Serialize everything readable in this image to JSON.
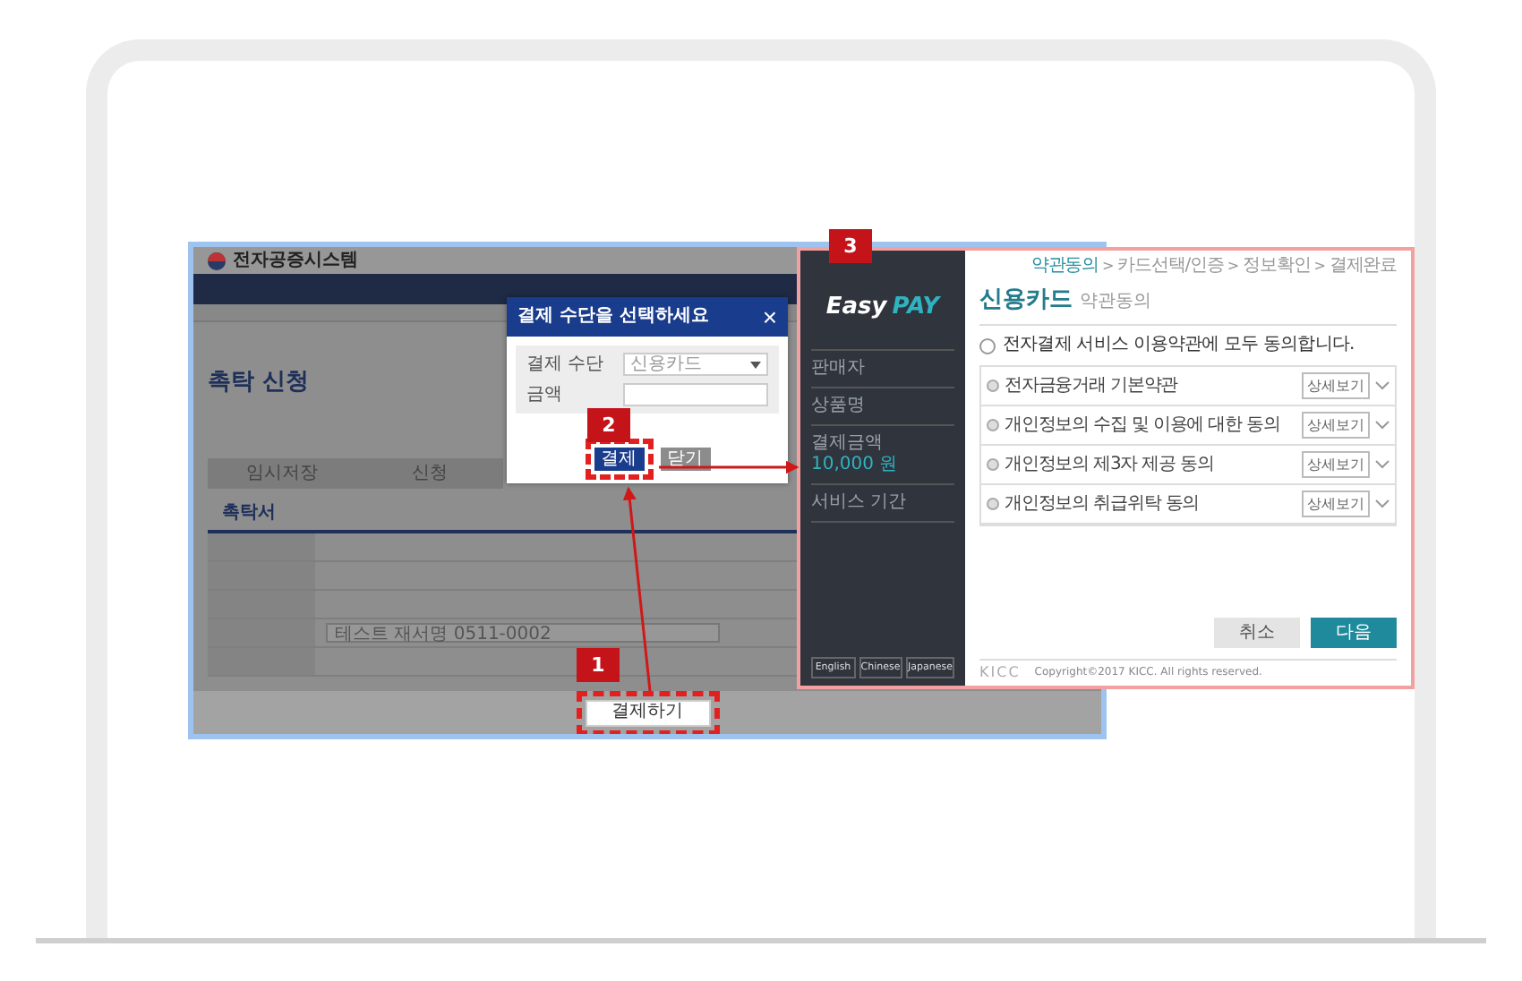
{
  "left_screen": {
    "site_name": "전자공증시스템",
    "title": "촉탁 신청",
    "steps": [
      "임시저장",
      "신청"
    ],
    "section": "촉탁서",
    "document_name": "테스트 재서명 0511-0002",
    "pay_button": "결제하기"
  },
  "payment_modal": {
    "title": "결제 수단을 선택하세요",
    "close": "×",
    "fields": [
      {
        "label": "결제 수단",
        "kind": "select",
        "value": "신용카드"
      },
      {
        "label": "금액",
        "kind": "input"
      }
    ],
    "buttons": [
      {
        "label": "결제",
        "kind": "primary"
      },
      {
        "label": "닫기",
        "kind": "secondary"
      }
    ]
  },
  "easypay": {
    "logo_left": "Easy",
    "logo_right": "PAY",
    "info": [
      {
        "label": "판매자"
      },
      {
        "label": "상품명"
      },
      {
        "label": "결제금액",
        "value": "10,000 원"
      },
      {
        "label": "서비스 기간"
      }
    ],
    "languages": [
      "English",
      "Chinese",
      "Japanese"
    ],
    "separator": ">",
    "steps": [
      {
        "label": "약관동의",
        "selected": true
      },
      {
        "label": "카드선택/인증",
        "selected": false
      },
      {
        "label": "정보확인",
        "selected": false
      },
      {
        "label": "결제완료",
        "selected": false
      }
    ],
    "title": "신용카드",
    "subtitle": "약관동의",
    "agree_all": {
      "label": "전자결제 서비스 이용약관에 모두 동의합니다.",
      "checked": false
    },
    "terms": [
      {
        "label": "전자금융거래 기본약관",
        "checked": false,
        "detail": "상세보기"
      },
      {
        "label": "개인정보의 수집 및 이용에 대한 동의",
        "checked": false,
        "detail": "상세보기"
      },
      {
        "label": "개인정보의 제3자 제공 동의",
        "checked": false,
        "detail": "상세보기"
      },
      {
        "label": "개인정보의 취급위탁 동의",
        "checked": false,
        "detail": "상세보기"
      }
    ],
    "buttons": [
      {
        "label": "취소",
        "kind": "secondary"
      },
      {
        "label": "다음",
        "kind": "primary"
      }
    ],
    "footer_logo": "KICC",
    "copyright": "Copyright©2017 KICC. All rights reserved."
  },
  "callouts": [
    "1",
    "2",
    "3"
  ]
}
